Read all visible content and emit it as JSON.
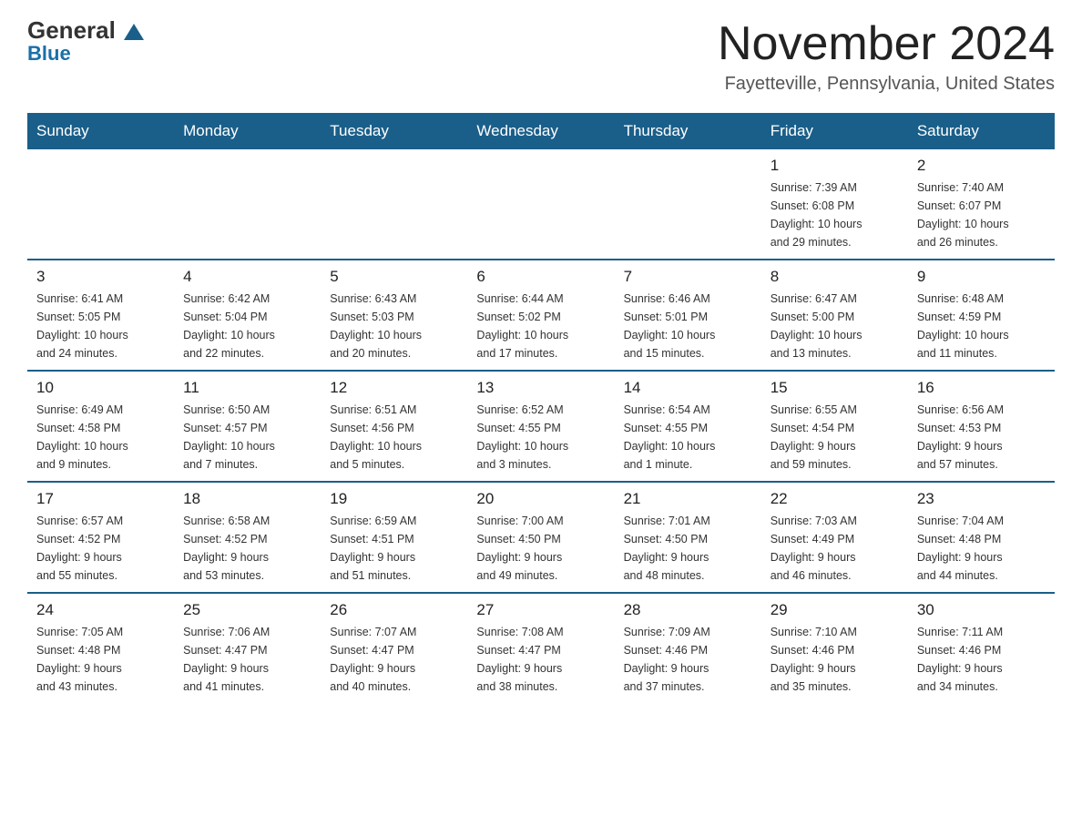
{
  "logo": {
    "general": "General",
    "blue": "Blue"
  },
  "title": "November 2024",
  "location": "Fayetteville, Pennsylvania, United States",
  "days_header": [
    "Sunday",
    "Monday",
    "Tuesday",
    "Wednesday",
    "Thursday",
    "Friday",
    "Saturday"
  ],
  "weeks": [
    [
      {
        "day": "",
        "info": ""
      },
      {
        "day": "",
        "info": ""
      },
      {
        "day": "",
        "info": ""
      },
      {
        "day": "",
        "info": ""
      },
      {
        "day": "",
        "info": ""
      },
      {
        "day": "1",
        "info": "Sunrise: 7:39 AM\nSunset: 6:08 PM\nDaylight: 10 hours\nand 29 minutes."
      },
      {
        "day": "2",
        "info": "Sunrise: 7:40 AM\nSunset: 6:07 PM\nDaylight: 10 hours\nand 26 minutes."
      }
    ],
    [
      {
        "day": "3",
        "info": "Sunrise: 6:41 AM\nSunset: 5:05 PM\nDaylight: 10 hours\nand 24 minutes."
      },
      {
        "day": "4",
        "info": "Sunrise: 6:42 AM\nSunset: 5:04 PM\nDaylight: 10 hours\nand 22 minutes."
      },
      {
        "day": "5",
        "info": "Sunrise: 6:43 AM\nSunset: 5:03 PM\nDaylight: 10 hours\nand 20 minutes."
      },
      {
        "day": "6",
        "info": "Sunrise: 6:44 AM\nSunset: 5:02 PM\nDaylight: 10 hours\nand 17 minutes."
      },
      {
        "day": "7",
        "info": "Sunrise: 6:46 AM\nSunset: 5:01 PM\nDaylight: 10 hours\nand 15 minutes."
      },
      {
        "day": "8",
        "info": "Sunrise: 6:47 AM\nSunset: 5:00 PM\nDaylight: 10 hours\nand 13 minutes."
      },
      {
        "day": "9",
        "info": "Sunrise: 6:48 AM\nSunset: 4:59 PM\nDaylight: 10 hours\nand 11 minutes."
      }
    ],
    [
      {
        "day": "10",
        "info": "Sunrise: 6:49 AM\nSunset: 4:58 PM\nDaylight: 10 hours\nand 9 minutes."
      },
      {
        "day": "11",
        "info": "Sunrise: 6:50 AM\nSunset: 4:57 PM\nDaylight: 10 hours\nand 7 minutes."
      },
      {
        "day": "12",
        "info": "Sunrise: 6:51 AM\nSunset: 4:56 PM\nDaylight: 10 hours\nand 5 minutes."
      },
      {
        "day": "13",
        "info": "Sunrise: 6:52 AM\nSunset: 4:55 PM\nDaylight: 10 hours\nand 3 minutes."
      },
      {
        "day": "14",
        "info": "Sunrise: 6:54 AM\nSunset: 4:55 PM\nDaylight: 10 hours\nand 1 minute."
      },
      {
        "day": "15",
        "info": "Sunrise: 6:55 AM\nSunset: 4:54 PM\nDaylight: 9 hours\nand 59 minutes."
      },
      {
        "day": "16",
        "info": "Sunrise: 6:56 AM\nSunset: 4:53 PM\nDaylight: 9 hours\nand 57 minutes."
      }
    ],
    [
      {
        "day": "17",
        "info": "Sunrise: 6:57 AM\nSunset: 4:52 PM\nDaylight: 9 hours\nand 55 minutes."
      },
      {
        "day": "18",
        "info": "Sunrise: 6:58 AM\nSunset: 4:52 PM\nDaylight: 9 hours\nand 53 minutes."
      },
      {
        "day": "19",
        "info": "Sunrise: 6:59 AM\nSunset: 4:51 PM\nDaylight: 9 hours\nand 51 minutes."
      },
      {
        "day": "20",
        "info": "Sunrise: 7:00 AM\nSunset: 4:50 PM\nDaylight: 9 hours\nand 49 minutes."
      },
      {
        "day": "21",
        "info": "Sunrise: 7:01 AM\nSunset: 4:50 PM\nDaylight: 9 hours\nand 48 minutes."
      },
      {
        "day": "22",
        "info": "Sunrise: 7:03 AM\nSunset: 4:49 PM\nDaylight: 9 hours\nand 46 minutes."
      },
      {
        "day": "23",
        "info": "Sunrise: 7:04 AM\nSunset: 4:48 PM\nDaylight: 9 hours\nand 44 minutes."
      }
    ],
    [
      {
        "day": "24",
        "info": "Sunrise: 7:05 AM\nSunset: 4:48 PM\nDaylight: 9 hours\nand 43 minutes."
      },
      {
        "day": "25",
        "info": "Sunrise: 7:06 AM\nSunset: 4:47 PM\nDaylight: 9 hours\nand 41 minutes."
      },
      {
        "day": "26",
        "info": "Sunrise: 7:07 AM\nSunset: 4:47 PM\nDaylight: 9 hours\nand 40 minutes."
      },
      {
        "day": "27",
        "info": "Sunrise: 7:08 AM\nSunset: 4:47 PM\nDaylight: 9 hours\nand 38 minutes."
      },
      {
        "day": "28",
        "info": "Sunrise: 7:09 AM\nSunset: 4:46 PM\nDaylight: 9 hours\nand 37 minutes."
      },
      {
        "day": "29",
        "info": "Sunrise: 7:10 AM\nSunset: 4:46 PM\nDaylight: 9 hours\nand 35 minutes."
      },
      {
        "day": "30",
        "info": "Sunrise: 7:11 AM\nSunset: 4:46 PM\nDaylight: 9 hours\nand 34 minutes."
      }
    ]
  ]
}
